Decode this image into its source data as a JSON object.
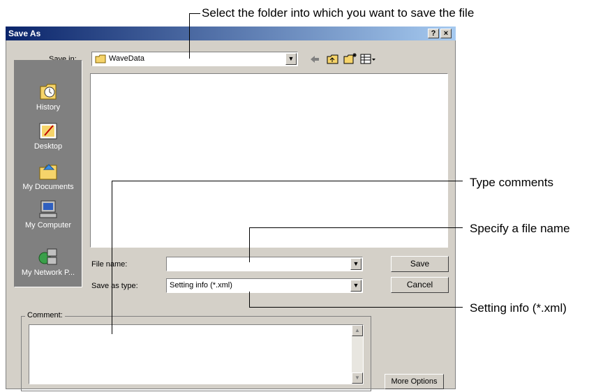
{
  "window": {
    "title": "Save As",
    "help_button": "?",
    "close_button": "×"
  },
  "toolbar": {
    "save_in_label": "Save in:",
    "save_in_value": "WaveData",
    "icons": [
      "folder-icon",
      "back-arrow-icon",
      "up-folder-icon",
      "new-folder-icon",
      "view-menu-icon"
    ]
  },
  "places": [
    {
      "label": "History",
      "icon": "history-icon"
    },
    {
      "label": "Desktop",
      "icon": "desktop-icon"
    },
    {
      "label": "My Documents",
      "icon": "my-documents-icon"
    },
    {
      "label": "My Computer",
      "icon": "my-computer-icon"
    },
    {
      "label": "My Network P...",
      "icon": "network-icon"
    }
  ],
  "form": {
    "file_name_label": "File name:",
    "file_name_value": "",
    "save_type_label": "Save as type:",
    "save_type_value": "Setting info (*.xml)",
    "save_button": "Save",
    "cancel_button": "Cancel",
    "comment_label": "Comment:",
    "comment_value": "",
    "more_options_button": "More Options"
  },
  "callouts": {
    "folder": "Select the folder into which you want to save the file",
    "comments": "Type comments",
    "file_name": "Specify a file name",
    "setting_info": "Setting info (*.xml)"
  },
  "colors": {
    "titlebar_start": "#0a246a",
    "titlebar_end": "#a6caf0",
    "dialog_face": "#d4d0c8",
    "places_bar": "#808080"
  }
}
